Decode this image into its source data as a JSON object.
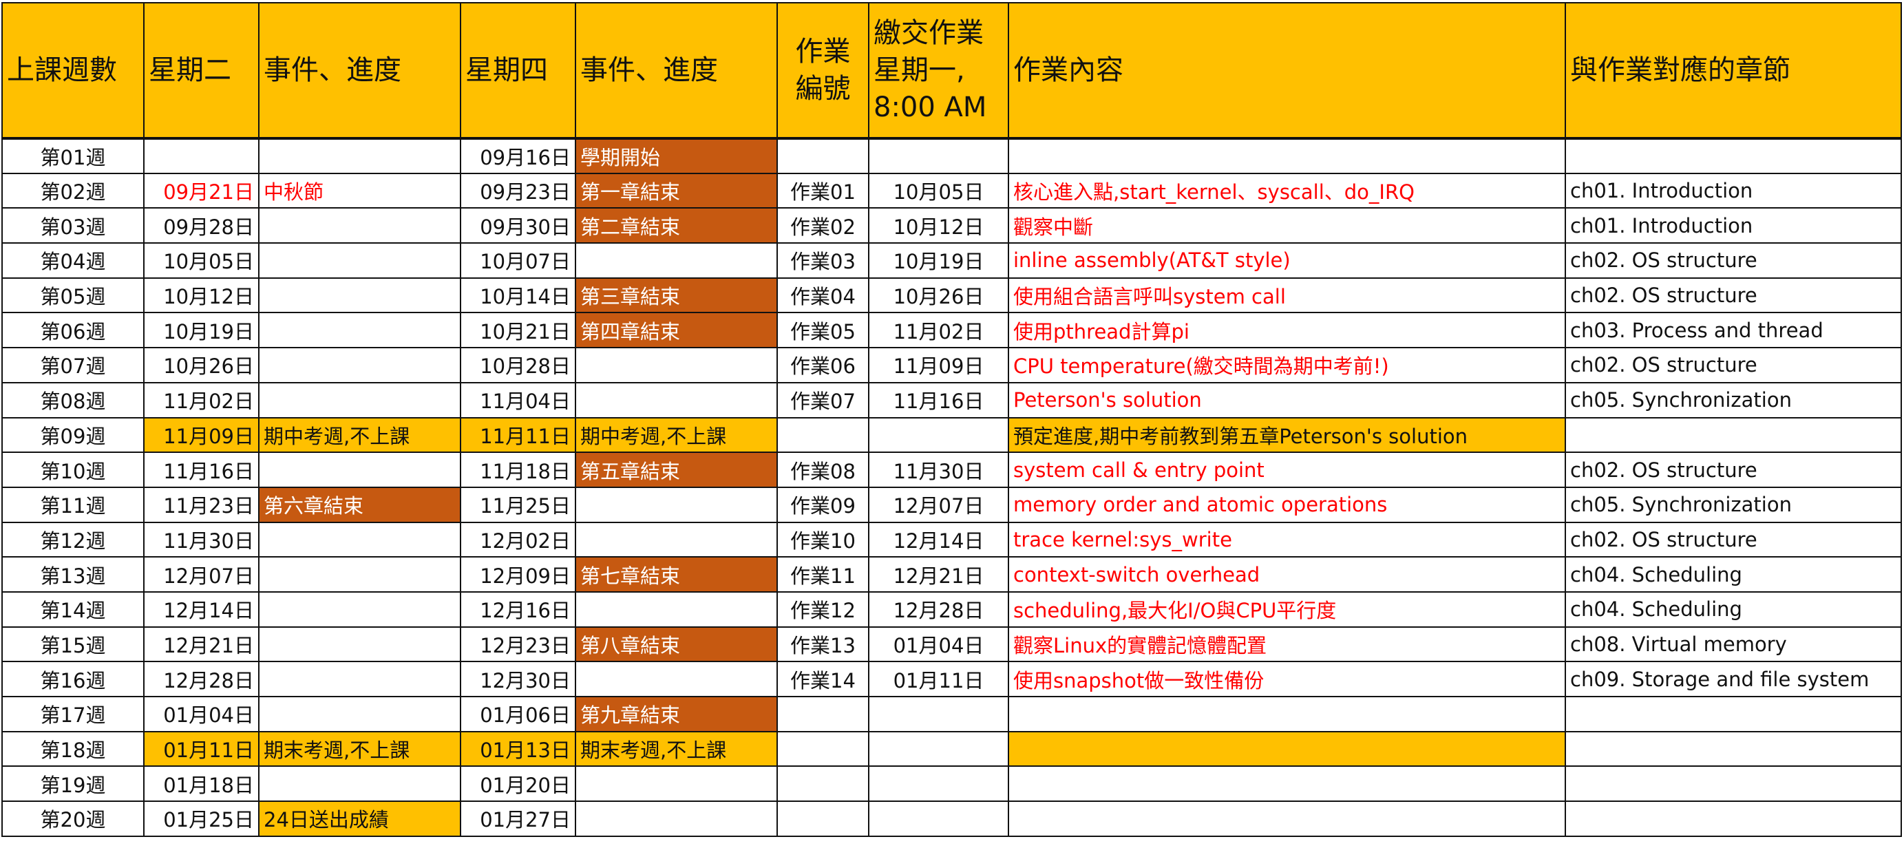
{
  "headers": {
    "week": "上課週數",
    "tue": "星期二",
    "event1": "事件、進度",
    "thu": "星期四",
    "event2": "事件、進度",
    "hw_no_line1": "作業",
    "hw_no_line2": "編號",
    "due_line1": "繳交作業",
    "due_line2": "星期一,",
    "due_line3": "8:00 AM",
    "hw_content": "作業內容",
    "chapter": "與作業對應的章節"
  },
  "rows": [
    {
      "week": "第01週",
      "tue": "",
      "event1": "",
      "thu": "09月16日",
      "event2": "學期開始",
      "hw_no": "",
      "due": "",
      "content": "",
      "chapter": ""
    },
    {
      "week": "第02週",
      "tue": "09月21日",
      "event1": "中秋節",
      "thu": "09月23日",
      "event2": "第一章結束",
      "hw_no": "作業01",
      "due": "10月05日",
      "content": "核心進入點,start_kernel、syscall、do_IRQ",
      "chapter": "ch01. Introduction"
    },
    {
      "week": "第03週",
      "tue": "09月28日",
      "event1": "",
      "thu": "09月30日",
      "event2": "第二章結束",
      "hw_no": "作業02",
      "due": "10月12日",
      "content": "觀察中斷",
      "chapter": "ch01. Introduction"
    },
    {
      "week": "第04週",
      "tue": "10月05日",
      "event1": "",
      "thu": "10月07日",
      "event2": "",
      "hw_no": "作業03",
      "due": "10月19日",
      "content": "inline assembly(AT&T style)",
      "chapter": "ch02. OS structure"
    },
    {
      "week": "第05週",
      "tue": "10月12日",
      "event1": "",
      "thu": "10月14日",
      "event2": "第三章結束",
      "hw_no": "作業04",
      "due": "10月26日",
      "content": "使用組合語言呼叫system call",
      "chapter": "ch02. OS structure"
    },
    {
      "week": "第06週",
      "tue": "10月19日",
      "event1": "",
      "thu": "10月21日",
      "event2": "第四章結束",
      "hw_no": "作業05",
      "due": "11月02日",
      "content": "使用pthread計算pi",
      "chapter": "ch03. Process and thread"
    },
    {
      "week": "第07週",
      "tue": "10月26日",
      "event1": "",
      "thu": "10月28日",
      "event2": "",
      "hw_no": "作業06",
      "due": "11月09日",
      "content": "CPU temperature(繳交時間為期中考前!)",
      "chapter": "ch02. OS structure"
    },
    {
      "week": "第08週",
      "tue": "11月02日",
      "event1": "",
      "thu": "11月04日",
      "event2": "",
      "hw_no": "作業07",
      "due": "11月16日",
      "content": "Peterson's solution",
      "chapter": "ch05. Synchronization"
    },
    {
      "week": "第09週",
      "tue": "11月09日",
      "event1": "期中考週,不上課",
      "thu": "11月11日",
      "event2": "期中考週,不上課",
      "hw_no": "",
      "due": "",
      "content": "預定進度,期中考前教到第五章Peterson's solution",
      "chapter": ""
    },
    {
      "week": "第10週",
      "tue": "11月16日",
      "event1": "",
      "thu": "11月18日",
      "event2": "第五章結束",
      "hw_no": "作業08",
      "due": "11月30日",
      "content": "system call & entry point",
      "chapter": "ch02. OS structure"
    },
    {
      "week": "第11週",
      "tue": "11月23日",
      "event1": "第六章結束",
      "thu": "11月25日",
      "event2": "",
      "hw_no": "作業09",
      "due": "12月07日",
      "content": "memory order and atomic operations",
      "chapter": "ch05. Synchronization"
    },
    {
      "week": "第12週",
      "tue": "11月30日",
      "event1": "",
      "thu": "12月02日",
      "event2": "",
      "hw_no": "作業10",
      "due": "12月14日",
      "content": "trace kernel:sys_write",
      "chapter": "ch02. OS structure"
    },
    {
      "week": "第13週",
      "tue": "12月07日",
      "event1": "",
      "thu": "12月09日",
      "event2": "第七章結束",
      "hw_no": "作業11",
      "due": "12月21日",
      "content": "context-switch overhead",
      "chapter": "ch04. Scheduling"
    },
    {
      "week": "第14週",
      "tue": "12月14日",
      "event1": "",
      "thu": "12月16日",
      "event2": "",
      "hw_no": "作業12",
      "due": "12月28日",
      "content": "scheduling,最大化I/O與CPU平行度",
      "chapter": "ch04. Scheduling"
    },
    {
      "week": "第15週",
      "tue": "12月21日",
      "event1": "",
      "thu": "12月23日",
      "event2": "第八章結束",
      "hw_no": "作業13",
      "due": "01月04日",
      "content": "觀察Linux的實體記憶體配置",
      "chapter": "ch08. Virtual memory"
    },
    {
      "week": "第16週",
      "tue": "12月28日",
      "event1": "",
      "thu": "12月30日",
      "event2": "",
      "hw_no": "作業14",
      "due": "01月11日",
      "content": "使用snapshot做一致性備份",
      "chapter": "ch09. Storage and file system"
    },
    {
      "week": "第17週",
      "tue": "01月04日",
      "event1": "",
      "thu": "01月06日",
      "event2": "第九章結束",
      "hw_no": "",
      "due": "",
      "content": "",
      "chapter": ""
    },
    {
      "week": "第18週",
      "tue": "01月11日",
      "event1": "期末考週,不上課",
      "thu": "01月13日",
      "event2": "期末考週,不上課",
      "hw_no": "",
      "due": "",
      "content": "",
      "chapter": ""
    },
    {
      "week": "第19週",
      "tue": "01月18日",
      "event1": "",
      "thu": "01月20日",
      "event2": "",
      "hw_no": "",
      "due": "",
      "content": "",
      "chapter": ""
    },
    {
      "week": "第20週",
      "tue": "01月25日",
      "event1": "24日送出成績",
      "thu": "01月27日",
      "event2": "",
      "hw_no": "",
      "due": "",
      "content": "",
      "chapter": ""
    }
  ],
  "colors": {
    "header_bg": "#FFC000",
    "chapter_end_bg": "#C65911",
    "exam_week_bg": "#FFC000",
    "homework_text": "#FF0000",
    "holiday_text": "#FF0000"
  }
}
